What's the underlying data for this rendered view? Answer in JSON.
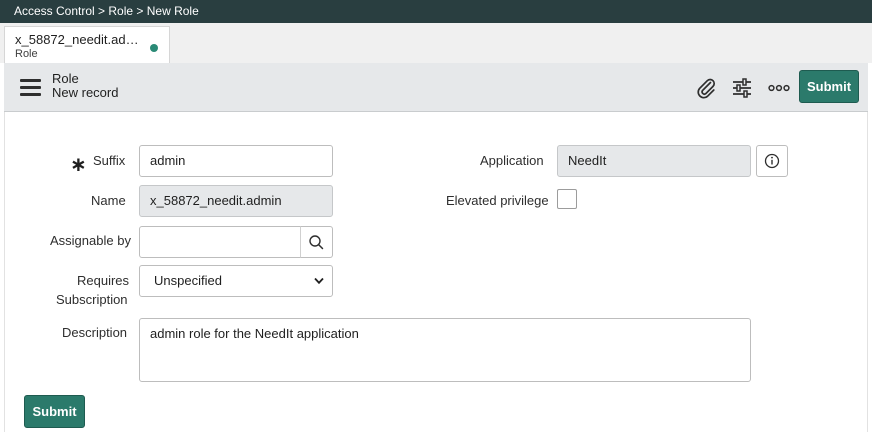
{
  "breadcrumb": "Access Control > Role > New Role",
  "tab": {
    "title": "x_58872_needit.ad…",
    "subtitle": "Role"
  },
  "header": {
    "title": "Role",
    "subtitle": "New record",
    "submit_label": "Submit",
    "icons": [
      "paperclip-icon",
      "sliders-icon",
      "more-options-icon"
    ]
  },
  "form": {
    "suffix": {
      "label": "Suffix",
      "value": "admin",
      "mandatory_symbol": "∗"
    },
    "name": {
      "label": "Name",
      "value": "x_58872_needit.admin"
    },
    "assignable_by": {
      "label": "Assignable by",
      "value": ""
    },
    "requires_subscription": {
      "label_line1": "Requires",
      "label_line2": "Subscription",
      "value": "Unspecified"
    },
    "description": {
      "label": "Description",
      "value": "admin role for the NeedIt application"
    },
    "application": {
      "label": "Application",
      "value": "NeedIt"
    },
    "elevated_privilege": {
      "label": "Elevated privilege",
      "checked": false
    }
  },
  "footer": {
    "submit_label": "Submit"
  },
  "colors": {
    "brand_dark": "#293e40",
    "submit_green": "#2b7a6b",
    "header_gray": "#e6e8ea"
  }
}
